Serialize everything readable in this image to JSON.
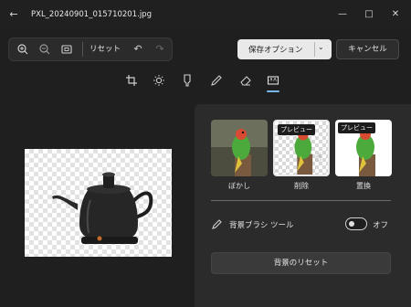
{
  "window": {
    "title": "PXL_20240901_015710201.jpg"
  },
  "toolbar": {
    "reset_label": "リセット"
  },
  "actions": {
    "save_label": "保存オプション",
    "cancel_label": "キャンセル"
  },
  "tools": [
    {
      "name": "crop-tool",
      "icon": "crop-icon"
    },
    {
      "name": "adjust-tool",
      "icon": "brightness-icon"
    },
    {
      "name": "filter-tool",
      "icon": "filter-icon"
    },
    {
      "name": "markup-tool",
      "icon": "pen-icon"
    },
    {
      "name": "erase-tool",
      "icon": "eraser-icon"
    },
    {
      "name": "background-tool",
      "icon": "background-icon",
      "selected": true
    }
  ],
  "background_panel": {
    "options": [
      {
        "caption": "ぼかし",
        "tag": ""
      },
      {
        "caption": "削除",
        "tag": "プレビュー",
        "selected": true
      },
      {
        "caption": "置換",
        "tag": "プレビュー"
      }
    ],
    "brush_label": "背景ブラシ ツール",
    "brush_toggle_state": "オフ",
    "reset_label": "背景のリセット"
  },
  "colors": {
    "accent": "#7ab7f0",
    "background": "#1f1f1f",
    "panel": "#2b2b2b"
  }
}
